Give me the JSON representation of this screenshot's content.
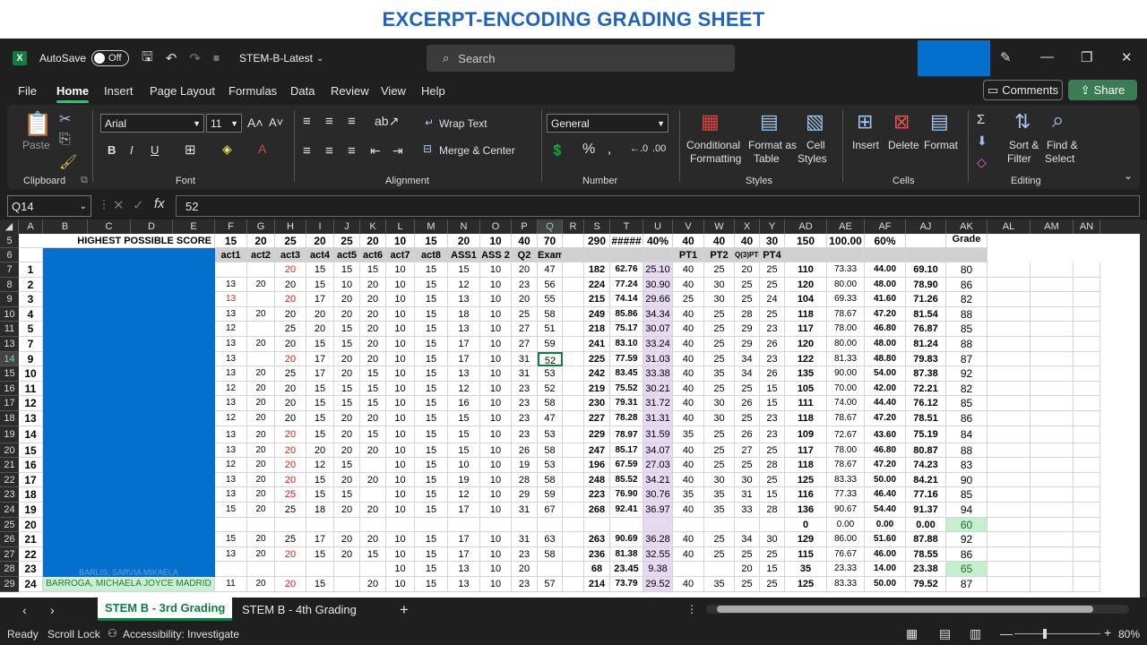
{
  "banner": "EXCERPT-ENCODING GRADING SHEET",
  "titlebar": {
    "autosave": "AutoSave",
    "toggle": "Off",
    "filename": "STEM-B-Latest",
    "search": "Search"
  },
  "menu": [
    "File",
    "Home",
    "Insert",
    "Page Layout",
    "Formulas",
    "Data",
    "Review",
    "View",
    "Help"
  ],
  "comments": "Comments",
  "share": "Share",
  "ribbon": {
    "paste": "Paste",
    "clipboard": "Clipboard",
    "font_name": "Arial",
    "font_size": "11",
    "font": "Font",
    "wrap": "Wrap Text",
    "merge": "Merge & Center",
    "alignment": "Alignment",
    "number_format": "General",
    "number": "Number",
    "cond1": "Conditional",
    "cond2": "Formatting",
    "fmt1": "Format as",
    "fmt2": "Table",
    "cs1": "Cell",
    "cs2": "Styles",
    "styles": "Styles",
    "insert": "Insert",
    "delete": "Delete",
    "format": "Format",
    "cells": "Cells",
    "sort1": "Sort &",
    "sort2": "Filter",
    "find1": "Find &",
    "find2": "Select",
    "editing": "Editing"
  },
  "namebox": "Q14",
  "formula": "52",
  "columns": [
    "A",
    "B",
    "C",
    "D",
    "E",
    "F",
    "G",
    "H",
    "I",
    "J",
    "K",
    "L",
    "M",
    "N",
    "O",
    "P",
    "Q",
    "R",
    "S",
    "T",
    "U",
    "V",
    "W",
    "X",
    "Y",
    "AD",
    "AE",
    "AF",
    "AJ",
    "AK",
    "AL",
    "AM",
    "AN"
  ],
  "header_row5": {
    "label": "HIGHEST POSSIBLE SCORE",
    "values": [
      "15",
      "20",
      "25",
      "20",
      "25",
      "20",
      "10",
      "15",
      "20",
      "10",
      "40",
      "70",
      "",
      "290",
      "#####",
      "40%",
      "40",
      "40",
      "40",
      "30",
      "150",
      "100.00",
      "60%",
      "",
      "Grade"
    ]
  },
  "header_row6": [
    "act1",
    "act2",
    "act3",
    "act4",
    "act5",
    "act6",
    "act7",
    "act8",
    "ASS1",
    "ASS 2",
    "Q2",
    "Exam",
    "",
    "",
    "",
    "",
    "PT1",
    "PT2",
    "Q(3)PT3",
    "PT4",
    "",
    "",
    "",
    "",
    ""
  ],
  "rows": [
    {
      "r": "7",
      "n": "1",
      "v": [
        "",
        "",
        "20",
        "15",
        "15",
        "15",
        "10",
        "15",
        "15",
        "10",
        "20",
        "47",
        "",
        "182",
        "62.76",
        "25.10",
        "40",
        "25",
        "20",
        "25",
        "110",
        "73.33",
        "44.00",
        "69.10",
        "80"
      ]
    },
    {
      "r": "8",
      "n": "2",
      "v": [
        "13",
        "20",
        "20",
        "15",
        "10",
        "20",
        "10",
        "15",
        "12",
        "10",
        "23",
        "56",
        "",
        "224",
        "77.24",
        "30.90",
        "40",
        "30",
        "25",
        "25",
        "120",
        "80.00",
        "48.00",
        "78.90",
        "86"
      ]
    },
    {
      "r": "9",
      "n": "3",
      "v": [
        "13",
        "",
        "20",
        "17",
        "20",
        "20",
        "10",
        "15",
        "13",
        "10",
        "20",
        "55",
        "",
        "215",
        "74.14",
        "29.66",
        "25",
        "30",
        "25",
        "24",
        "104",
        "69.33",
        "41.60",
        "71.26",
        "82"
      ]
    },
    {
      "r": "10",
      "n": "4",
      "v": [
        "13",
        "20",
        "20",
        "20",
        "20",
        "20",
        "10",
        "15",
        "18",
        "10",
        "25",
        "58",
        "",
        "249",
        "85.86",
        "34.34",
        "40",
        "25",
        "28",
        "25",
        "118",
        "78.67",
        "47.20",
        "81.54",
        "88"
      ]
    },
    {
      "r": "11",
      "n": "5",
      "v": [
        "12",
        "",
        "25",
        "20",
        "15",
        "20",
        "10",
        "15",
        "13",
        "10",
        "27",
        "51",
        "",
        "218",
        "75.17",
        "30.07",
        "40",
        "25",
        "29",
        "23",
        "117",
        "78.00",
        "46.80",
        "76.87",
        "85"
      ]
    },
    {
      "r": "13",
      "n": "7",
      "v": [
        "13",
        "20",
        "20",
        "15",
        "15",
        "20",
        "10",
        "15",
        "17",
        "10",
        "27",
        "59",
        "",
        "241",
        "83.10",
        "33.24",
        "40",
        "25",
        "29",
        "26",
        "120",
        "80.00",
        "48.00",
        "81.24",
        "88"
      ]
    },
    {
      "r": "14",
      "n": "9",
      "v": [
        "13",
        "",
        "20",
        "17",
        "20",
        "20",
        "10",
        "15",
        "17",
        "10",
        "31",
        "52",
        "",
        "225",
        "77.59",
        "31.03",
        "40",
        "25",
        "34",
        "23",
        "122",
        "81.33",
        "48.80",
        "79.83",
        "87"
      ]
    },
    {
      "r": "15",
      "n": "10",
      "v": [
        "13",
        "20",
        "25",
        "17",
        "20",
        "15",
        "10",
        "15",
        "13",
        "10",
        "31",
        "53",
        "",
        "242",
        "83.45",
        "33.38",
        "40",
        "35",
        "34",
        "26",
        "135",
        "90.00",
        "54.00",
        "87.38",
        "92"
      ]
    },
    {
      "r": "16",
      "n": "11",
      "v": [
        "12",
        "20",
        "20",
        "15",
        "15",
        "15",
        "10",
        "15",
        "12",
        "10",
        "23",
        "52",
        "",
        "219",
        "75.52",
        "30.21",
        "40",
        "25",
        "25",
        "15",
        "105",
        "70.00",
        "42.00",
        "72.21",
        "82"
      ]
    },
    {
      "r": "17",
      "n": "12",
      "v": [
        "13",
        "20",
        "20",
        "15",
        "15",
        "15",
        "10",
        "15",
        "16",
        "10",
        "23",
        "58",
        "",
        "230",
        "79.31",
        "31.72",
        "40",
        "30",
        "26",
        "15",
        "111",
        "74.00",
        "44.40",
        "76.12",
        "85"
      ]
    },
    {
      "r": "18",
      "n": "13",
      "v": [
        "12",
        "20",
        "20",
        "15",
        "20",
        "20",
        "10",
        "15",
        "15",
        "10",
        "23",
        "47",
        "",
        "227",
        "78.28",
        "31.31",
        "40",
        "30",
        "25",
        "23",
        "118",
        "78.67",
        "47.20",
        "78.51",
        "86"
      ]
    },
    {
      "r": "19",
      "n": "14",
      "v": [
        "13",
        "20",
        "20",
        "15",
        "20",
        "15",
        "10",
        "15",
        "15",
        "10",
        "23",
        "53",
        "",
        "229",
        "78.97",
        "31.59",
        "35",
        "25",
        "26",
        "23",
        "109",
        "72.67",
        "43.60",
        "75.19",
        "84"
      ]
    },
    {
      "r": "20",
      "n": "15",
      "v": [
        "13",
        "20",
        "20",
        "20",
        "20",
        "20",
        "10",
        "15",
        "15",
        "10",
        "26",
        "58",
        "",
        "247",
        "85.17",
        "34.07",
        "40",
        "25",
        "27",
        "25",
        "117",
        "78.00",
        "46.80",
        "80.87",
        "88"
      ]
    },
    {
      "r": "21",
      "n": "16",
      "v": [
        "12",
        "20",
        "20",
        "12",
        "15",
        "",
        "10",
        "15",
        "10",
        "10",
        "19",
        "53",
        "",
        "196",
        "67.59",
        "27.03",
        "40",
        "25",
        "25",
        "28",
        "118",
        "78.67",
        "47.20",
        "74.23",
        "83"
      ]
    },
    {
      "r": "22",
      "n": "17",
      "v": [
        "13",
        "20",
        "20",
        "15",
        "20",
        "20",
        "10",
        "15",
        "19",
        "10",
        "28",
        "58",
        "",
        "248",
        "85.52",
        "34.21",
        "40",
        "30",
        "30",
        "25",
        "125",
        "83.33",
        "50.00",
        "84.21",
        "90"
      ]
    },
    {
      "r": "23",
      "n": "18",
      "v": [
        "13",
        "20",
        "25",
        "15",
        "15",
        "",
        "10",
        "15",
        "12",
        "10",
        "29",
        "59",
        "",
        "223",
        "76.90",
        "30.76",
        "35",
        "35",
        "31",
        "15",
        "116",
        "77.33",
        "46.40",
        "77.16",
        "85"
      ]
    },
    {
      "r": "24",
      "n": "19",
      "v": [
        "15",
        "20",
        "25",
        "18",
        "20",
        "20",
        "10",
        "15",
        "17",
        "10",
        "31",
        "67",
        "",
        "268",
        "92.41",
        "36.97",
        "40",
        "35",
        "33",
        "28",
        "136",
        "90.67",
        "54.40",
        "91.37",
        "94"
      ]
    },
    {
      "r": "25",
      "n": "20",
      "v": [
        "",
        "",
        "",
        "",
        "",
        "",
        "",
        "",
        "",
        "",
        "",
        "",
        "",
        "",
        "",
        "",
        "",
        "",
        "",
        "",
        "0",
        "0.00",
        "0.00",
        "0.00",
        "60"
      ]
    },
    {
      "r": "26",
      "n": "21",
      "v": [
        "15",
        "20",
        "25",
        "17",
        "20",
        "20",
        "10",
        "15",
        "17",
        "10",
        "31",
        "63",
        "",
        "263",
        "90.69",
        "36.28",
        "40",
        "25",
        "34",
        "30",
        "129",
        "86.00",
        "51.60",
        "87.88",
        "92"
      ]
    },
    {
      "r": "27",
      "n": "22",
      "v": [
        "13",
        "20",
        "20",
        "15",
        "20",
        "15",
        "10",
        "15",
        "17",
        "10",
        "23",
        "58",
        "",
        "236",
        "81.38",
        "32.55",
        "40",
        "25",
        "25",
        "25",
        "115",
        "76.67",
        "46.00",
        "78.55",
        "86"
      ]
    },
    {
      "r": "28",
      "n": "23",
      "v": [
        "",
        "",
        "",
        "",
        "",
        "",
        "10",
        "15",
        "13",
        "10",
        "20",
        "",
        "",
        "68",
        "23.45",
        "9.38",
        "",
        "",
        "20",
        "15",
        "35",
        "23.33",
        "14.00",
        "23.38",
        "65"
      ]
    },
    {
      "r": "29",
      "n": "24",
      "v": [
        "11",
        "20",
        "20",
        "15",
        "",
        "20",
        "10",
        "15",
        "13",
        "10",
        "23",
        "57",
        "",
        "214",
        "73.79",
        "29.52",
        "40",
        "35",
        "25",
        "25",
        "125",
        "83.33",
        "50.00",
        "79.52",
        "87"
      ]
    }
  ],
  "name_partial_28": "BARLIS, SARVIA MIKAELA",
  "name_29": "BARROGA, MICHAELA JOYCE MADRID",
  "sheets": [
    "STEM B - 3rd Grading",
    "STEM B - 4th Grading"
  ],
  "status": {
    "ready": "Ready",
    "scroll": "Scroll Lock",
    "access": "Accessibility: Investigate",
    "zoom": "80%"
  },
  "colors": {
    "accent": "#107c41",
    "name_block": "#0270cc",
    "red_text": "#d02020"
  }
}
